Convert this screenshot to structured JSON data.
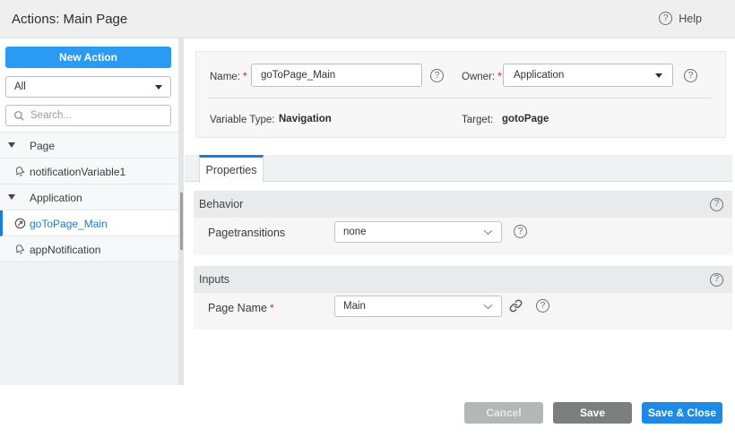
{
  "header": {
    "title": "Actions: Main Page",
    "help_label": "Help"
  },
  "sidebar": {
    "new_action_label": "New Action",
    "filter_value": "All",
    "search_placeholder": "Search...",
    "tree": [
      {
        "label": "Page",
        "type": "group"
      },
      {
        "label": "notificationVariable1",
        "type": "notification"
      },
      {
        "label": "Application",
        "type": "group"
      },
      {
        "label": "goToPage_Main",
        "type": "navigation",
        "selected": true
      },
      {
        "label": "appNotification",
        "type": "notification"
      }
    ]
  },
  "form": {
    "name_label": "Name:",
    "name_required": "*",
    "name_value": "goToPage_Main",
    "owner_label": "Owner:",
    "owner_required": "*",
    "owner_value": "Application",
    "variable_type_label": "Variable Type:",
    "variable_type_value": "Navigation",
    "target_label": "Target:",
    "target_value": "gotoPage"
  },
  "tabs": {
    "properties_label": "Properties"
  },
  "sections": {
    "behavior": {
      "title": "Behavior",
      "field_label": "Pagetransitions",
      "field_value": "none"
    },
    "inputs": {
      "title": "Inputs",
      "field_label": "Page Name",
      "field_required": "*",
      "field_value": "Main"
    }
  },
  "footer": {
    "cancel_label": "Cancel",
    "save_label": "Save",
    "save_close_label": "Save & Close"
  },
  "colors": {
    "accent_blue": "#2b9af3",
    "primary_blue": "#1e8ae4",
    "selected_blue": "#1c7cd6",
    "header_bg": "#efefef",
    "section_header_bg": "#e9eaeb",
    "panel_bg": "#f7f7f8"
  }
}
